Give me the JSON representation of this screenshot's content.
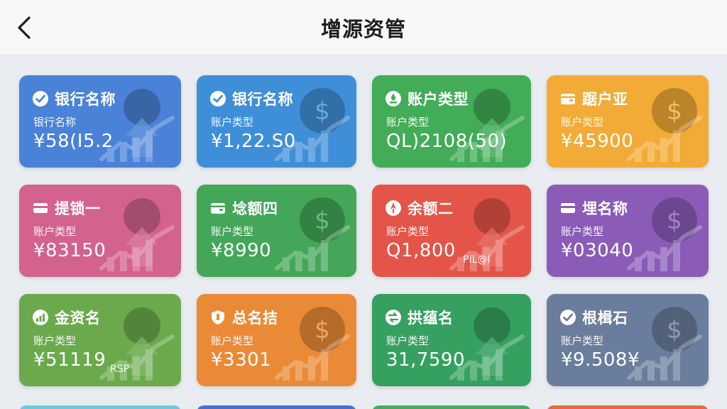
{
  "header": {
    "title": "增源资管"
  },
  "cards": [
    {
      "name": "银行名称",
      "sub": "银行名称",
      "amount": "¥58(I5.2",
      "tag": "",
      "color": "#4a82d8",
      "icon": "check-badge-icon"
    },
    {
      "name": "银行名称",
      "sub": "账户类型",
      "amount": "¥1,22.S0",
      "tag": "",
      "color": "#3f8fd8",
      "icon": "check-badge-icon"
    },
    {
      "name": "账户类型",
      "sub": "账户类型",
      "amount": "QL)2108(50)",
      "tag": "",
      "color": "#42ac57",
      "icon": "leaf-badge-icon"
    },
    {
      "name": "踞户亚",
      "sub": "账户类型",
      "amount": "¥45900",
      "tag": "",
      "color": "#f2ab36",
      "icon": "wallet-icon"
    },
    {
      "name": "提锁一",
      "sub": "账户类型",
      "amount": "¥83150",
      "tag": "",
      "color": "#d4628e",
      "icon": "card-icon"
    },
    {
      "name": "埝额四",
      "sub": "账户类型",
      "amount": "¥8990",
      "tag": "",
      "color": "#44a658",
      "icon": "wallet-icon"
    },
    {
      "name": "余额二",
      "sub": "账户类型",
      "amount": "Q1,800",
      "tag": "PIL@I",
      "color": "#e45448",
      "icon": "flame-icon"
    },
    {
      "name": "埋名称",
      "sub": "账户类型",
      "amount": "¥03040",
      "tag": "",
      "color": "#8a5cb8",
      "icon": "card-icon"
    },
    {
      "name": "金资名",
      "sub": "账户类型",
      "amount": "¥51119",
      "tag": "RSP",
      "color": "#6aaa4c",
      "icon": "chart-badge-icon"
    },
    {
      "name": "总名拮",
      "sub": "账户类型",
      "amount": "¥3301",
      "tag": "",
      "color": "#ea8a36",
      "icon": "shield-icon"
    },
    {
      "name": "拱蕴名",
      "sub": "账户类型",
      "amount": "31,7590",
      "tag": "",
      "color": "#36a060",
      "icon": "swap-icon"
    },
    {
      "name": "根楫石",
      "sub": "账户类型",
      "amount": "¥9.508¥",
      "tag": "",
      "color": "#6a7d9c",
      "icon": "check-badge-icon"
    }
  ],
  "partial_row_colors": [
    "#6cc7e0",
    "#4a6fd0",
    "#4aa865",
    "#e8693e"
  ]
}
